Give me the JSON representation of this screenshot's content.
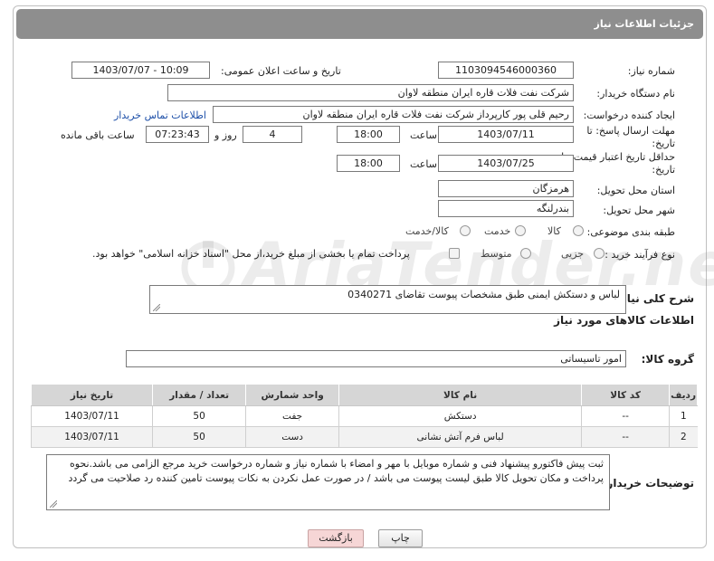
{
  "header": {
    "title": "جزئیات اطلاعات نیاز"
  },
  "watermark": "AriaTender.net",
  "form": {
    "need_number_label": "شماره نیاز:",
    "need_number": "1103094546000360",
    "announce_label": "تاریخ و ساعت اعلان عمومی:",
    "announce_value": "1403/07/07 - 10:09",
    "buyer_org_label": "نام دستگاه خریدار:",
    "buyer_org": "شرکت نفت فلات قاره ایران منطقه لاوان",
    "requester_label": "ایجاد کننده درخواست:",
    "requester": "رحیم قلی پور کارپرداز شرکت نفت فلات قاره ایران منطقه لاوان",
    "buyer_contact_link": "اطلاعات تماس خریدار",
    "reply_deadline_label_1": "مهلت ارسال پاسخ: تا",
    "reply_deadline_label_2": "تاریخ:",
    "reply_date": "1403/07/11",
    "time_label": "ساعت",
    "reply_time": "18:00",
    "days_value": "4",
    "days_label": "روز و",
    "remaining_time": "07:23:43",
    "remaining_label": "ساعت باقی مانده",
    "price_validity_label_1": "حداقل تاریخ اعتبار قیمت: تا",
    "price_validity_label_2": "تاریخ:",
    "validity_date": "1403/07/25",
    "validity_time": "18:00",
    "province_label": "استان محل تحویل:",
    "province": "هرمزگان",
    "city_label": "شهر محل تحویل:",
    "city": "بندرلنگه",
    "category_label": "طبقه بندی موضوعی:",
    "category_options": [
      "کالا",
      "خدمت",
      "کالا/خدمت"
    ],
    "process_label": "نوع فرآیند خرید :",
    "process_options": [
      "جزیی",
      "متوسط"
    ],
    "payment_note": "پرداخت تمام یا بخشی از مبلغ خرید،از محل \"اسناد خزانه اسلامی\" خواهد بود."
  },
  "description": {
    "label": "شرح کلی نیاز:",
    "value": "لباس و دستکش ایمنی طبق مشخصات پیوست تقاضای 0340271"
  },
  "goods": {
    "section_title": "اطلاعات کالاهای مورد نیاز",
    "group_label": "گروه کالا:",
    "group_value": "امور تاسیساتی",
    "columns": [
      "ردیف",
      "کد کالا",
      "نام کالا",
      "واحد شمارش",
      "تعداد / مقدار",
      "تاریخ نیاز"
    ],
    "rows": [
      [
        "1",
        "--",
        "دستکش",
        "جفت",
        "50",
        "1403/07/11"
      ],
      [
        "2",
        "--",
        "لباس فرم آتش نشانی",
        "دست",
        "50",
        "1403/07/11"
      ]
    ]
  },
  "buyer_notes": {
    "label": "توضیحات خریدار:",
    "value": "ثبت پیش فاکتورو پیشنهاد فنی و شماره موبایل با مهر و امضاء با شماره نیاز و شماره درخواست خرید مرجع الزامی می باشد.نحوه پرداخت و مکان تحویل کالا طبق لیست پیوست می باشد / در صورت عمل نکردن به نکات پیوست تامین کننده رد صلاحیت می گردد"
  },
  "buttons": {
    "print": "چاپ",
    "back": "بازگشت"
  },
  "colors": {
    "header_bg": "#8e8e8e",
    "link": "#1d4fa8",
    "back_button": "#f6d6d6",
    "table_header": "#d6d6d6"
  }
}
